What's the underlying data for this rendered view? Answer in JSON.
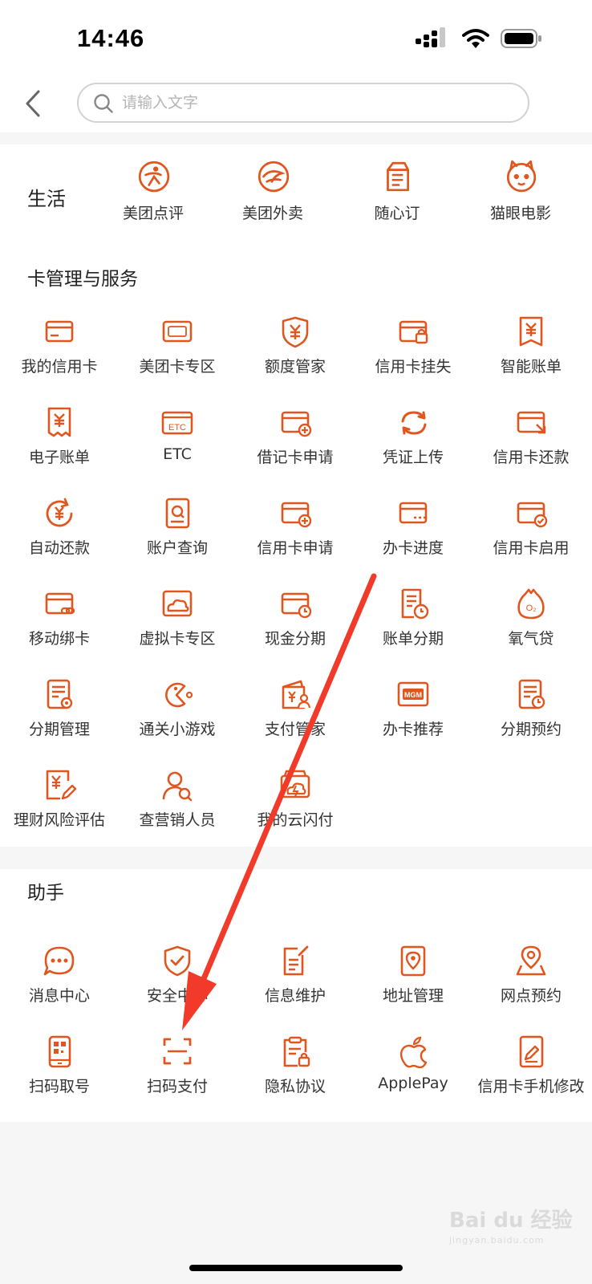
{
  "status_bar": {
    "time": "14:46"
  },
  "search": {
    "placeholder": "请输入文字"
  },
  "life": {
    "title": "生活",
    "items": [
      {
        "label": "美团点评",
        "icon": "meituan-dianping-icon"
      },
      {
        "label": "美团外卖",
        "icon": "meituan-waimai-icon"
      },
      {
        "label": "随心订",
        "icon": "milk-box-icon"
      },
      {
        "label": "猫眼电影",
        "icon": "cat-eye-icon"
      }
    ]
  },
  "card_services": {
    "title": "卡管理与服务",
    "items": [
      {
        "label": "我的信用卡",
        "icon": "credit-card-icon"
      },
      {
        "label": "美团卡专区",
        "icon": "meituan-card-icon"
      },
      {
        "label": "额度管家",
        "icon": "yuan-shield-icon"
      },
      {
        "label": "信用卡挂失",
        "icon": "card-lock-icon"
      },
      {
        "label": "智能账单",
        "icon": "yuan-bill-icon"
      },
      {
        "label": "电子账单",
        "icon": "yuan-receipt-icon"
      },
      {
        "label": "ETC",
        "icon": "etc-card-icon"
      },
      {
        "label": "借记卡申请",
        "icon": "card-add-icon"
      },
      {
        "label": "凭证上传",
        "icon": "sync-arrows-icon"
      },
      {
        "label": "信用卡还款",
        "icon": "card-repay-icon"
      },
      {
        "label": "自动还款",
        "icon": "yuan-cycle-icon"
      },
      {
        "label": "账户查询",
        "icon": "account-query-icon"
      },
      {
        "label": "信用卡申请",
        "icon": "card-add-icon"
      },
      {
        "label": "办卡进度",
        "icon": "card-progress-icon"
      },
      {
        "label": "信用卡启用",
        "icon": "card-check-icon"
      },
      {
        "label": "移动绑卡",
        "icon": "card-link-icon"
      },
      {
        "label": "虚拟卡专区",
        "icon": "card-cloud-icon"
      },
      {
        "label": "现金分期",
        "icon": "card-clock-icon"
      },
      {
        "label": "账单分期",
        "icon": "bill-clock-icon"
      },
      {
        "label": "氧气贷",
        "icon": "o2-bag-icon"
      },
      {
        "label": "分期管理",
        "icon": "doc-gear-icon"
      },
      {
        "label": "通关小游戏",
        "icon": "pacman-icon"
      },
      {
        "label": "支付管家",
        "icon": "wallet-person-icon"
      },
      {
        "label": "办卡推荐",
        "icon": "mgm-card-icon"
      },
      {
        "label": "分期预约",
        "icon": "doc-clock-icon"
      },
      {
        "label": "理财风险评估",
        "icon": "yuan-doc-edit-icon"
      },
      {
        "label": "查营销人员",
        "icon": "person-search-icon"
      },
      {
        "label": "我的云闪付",
        "icon": "card-flash-icon"
      }
    ]
  },
  "assistant": {
    "title": "助手",
    "items": [
      {
        "label": "消息中心",
        "icon": "chat-bubble-icon"
      },
      {
        "label": "安全中心",
        "icon": "shield-check-icon"
      },
      {
        "label": "信息维护",
        "icon": "doc-edit-icon"
      },
      {
        "label": "地址管理",
        "icon": "doc-pin-icon"
      },
      {
        "label": "网点预约",
        "icon": "location-pin-icon"
      },
      {
        "label": "扫码取号",
        "icon": "phone-qr-icon"
      },
      {
        "label": "扫码支付",
        "icon": "scan-frame-icon"
      },
      {
        "label": "隐私协议",
        "icon": "clipboard-lock-icon"
      },
      {
        "label": "ApplePay",
        "icon": "apple-icon"
      },
      {
        "label": "信用卡手机修改",
        "icon": "card-edit-icon"
      }
    ]
  },
  "watermark": {
    "text": "Bai du 经验",
    "sub": "jingyan.baidu.com"
  },
  "colors": {
    "accent": "#e0561e",
    "annotation_arrow": "#f23a2a",
    "background": "#f6f6f6"
  }
}
